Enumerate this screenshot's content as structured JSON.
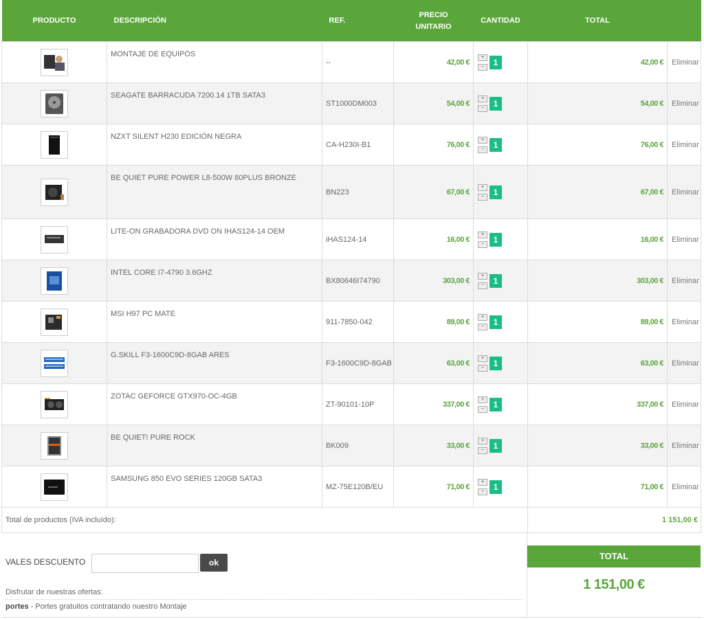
{
  "headers": {
    "producto": "PRODUCTO",
    "descripcion": "DESCRIPCIÓN",
    "ref": "REF.",
    "precio_line1": "PRECIO",
    "precio_line2": "UNITARIO",
    "cantidad": "CANTIDAD",
    "total": "TOTAL"
  },
  "colors": {
    "accent": "#5aa63b",
    "qty_badge": "#1abc8a",
    "ok_button": "#4a4a4a"
  },
  "rows": [
    {
      "image": "technician-image",
      "description": "MONTAJE DE EQUIPOS",
      "ref": "--",
      "unit_price": "42,00 €",
      "quantity": "1",
      "total": "42,00 €",
      "delete": "Eliminar"
    },
    {
      "image": "hard-drive-image",
      "description": "SEAGATE BARRACUDA 7200.14 1TB SATA3",
      "ref": "ST1000DM003",
      "unit_price": "54,00 €",
      "quantity": "1",
      "total": "54,00 €",
      "delete": "Eliminar"
    },
    {
      "image": "pc-case-image",
      "description": "NZXT SILENT H230 EDICIÓN NEGRA",
      "ref": "CA-H230I-B1",
      "unit_price": "76,00 €",
      "quantity": "1",
      "total": "76,00 €",
      "delete": "Eliminar"
    },
    {
      "image": "power-supply-image",
      "description": "BE QUIET PURE POWER L8-500W 80PLUS BRONZE",
      "ref": "BN223",
      "unit_price": "67,00 €",
      "quantity": "1",
      "total": "67,00 €",
      "delete": "Eliminar"
    },
    {
      "image": "dvd-drive-image",
      "description": "LITE-ON GRABADORA DVD ON IHAS124-14 OEM",
      "ref": "iHAS124-14",
      "unit_price": "16,00 €",
      "quantity": "1",
      "total": "16,00 €",
      "delete": "Eliminar"
    },
    {
      "image": "cpu-box-image",
      "description": "INTEL CORE I7-4790 3.6GHZ",
      "ref": "BX80646I74790",
      "unit_price": "303,00 €",
      "quantity": "1",
      "total": "303,00 €",
      "delete": "Eliminar"
    },
    {
      "image": "motherboard-image",
      "description": "MSI H97 PC MATE",
      "ref": "911-7850-042",
      "unit_price": "89,00 €",
      "quantity": "1",
      "total": "89,00 €",
      "delete": "Eliminar"
    },
    {
      "image": "ram-image",
      "description": "G.SKILL F3-1600C9D-8GAB ARES",
      "ref": "F3-1600C9D-8GAB",
      "unit_price": "63,00 €",
      "quantity": "1",
      "total": "63,00 €",
      "delete": "Eliminar"
    },
    {
      "image": "graphics-card-image",
      "description": "ZOTAC GEFORCE GTX970-OC-4GB",
      "ref": "ZT-90101-10P",
      "unit_price": "337,00 €",
      "quantity": "1",
      "total": "337,00 €",
      "delete": "Eliminar"
    },
    {
      "image": "cpu-cooler-image",
      "description": "BE QUIET! PURE ROCK",
      "ref": "BK009",
      "unit_price": "33,00 €",
      "quantity": "1",
      "total": "33,00 €",
      "delete": "Eliminar"
    },
    {
      "image": "ssd-image",
      "description": "SAMSUNG 850 EVO SERIES 120GB SATA3",
      "ref": "MZ-75E120B/EU",
      "unit_price": "71,00 €",
      "quantity": "1",
      "total": "71,00 €",
      "delete": "Eliminar"
    }
  ],
  "footer": {
    "products_total_label": "Total de productos (IVA incluído):",
    "products_total_value": "1 151,00 €"
  },
  "vouchers": {
    "label": "VALES DESCUENTO",
    "input_value": "",
    "ok_label": "ok",
    "offers_label": "Disfrutar de nuestras ofertas:",
    "offer_code": "portes",
    "offer_text": " - Portes gratuitos contratando nuestro Montaje"
  },
  "grand_total": {
    "label": "TOTAL",
    "value": "1 151,00 €"
  }
}
